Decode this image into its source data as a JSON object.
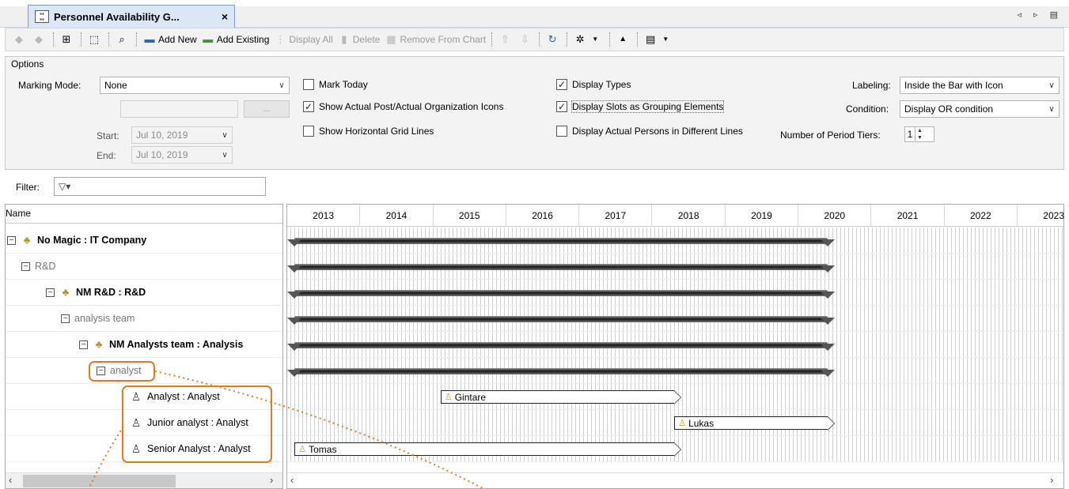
{
  "tab": {
    "title": "Personnel Availability G...",
    "close": "×",
    "nav": "◃ ▹ ▤"
  },
  "toolbar": {
    "add_new": "Add New",
    "add_existing": "Add Existing",
    "display_all": "Display All",
    "delete": "Delete",
    "remove_from_chart": "Remove From Chart"
  },
  "options": {
    "legend": "Options",
    "marking_mode_label": "Marking Mode:",
    "marking_mode_value": "None",
    "start_label": "Start:",
    "start_value": "Jul 10, 2019",
    "end_label": "End:",
    "end_value": "Jul 10, 2019",
    "ellipsis": "...",
    "mark_today": "Mark Today",
    "show_icons": "Show Actual Post/Actual Organization Icons",
    "show_grid": "Show Horizontal Grid Lines",
    "display_types": "Display Types",
    "display_slots": "Display Slots as Grouping Elements",
    "display_persons": "Display Actual Persons in Different Lines",
    "labeling_label": "Labeling:",
    "labeling_value": "Inside the Bar with Icon",
    "condition_label": "Condition:",
    "condition_value": "Display OR condition",
    "tiers_label": "Number of Period Tiers:",
    "tiers_value": "1"
  },
  "filter": {
    "label": "Filter:",
    "icon_text": "▽▾"
  },
  "tree": {
    "header": "Name",
    "rows": [
      {
        "label": "No Magic : IT Company"
      },
      {
        "label": "R&D"
      },
      {
        "label": "NM R&D : R&D"
      },
      {
        "label": "analysis team"
      },
      {
        "label": "NM Analysts team : Analysis"
      },
      {
        "label": "analyst"
      },
      {
        "label": "Analyst : Analyst"
      },
      {
        "label": "Junior analyst : Analyst"
      },
      {
        "label": "Senior Analyst : Analyst"
      }
    ]
  },
  "chart": {
    "years": [
      "2013",
      "2014",
      "2015",
      "2016",
      "2017",
      "2018",
      "2019",
      "2020",
      "2021",
      "2022",
      "2023"
    ],
    "assignments": [
      {
        "name": "Gintare"
      },
      {
        "name": "Lukas"
      },
      {
        "name": "Tomas"
      }
    ]
  },
  "chart_data": {
    "type": "gantt",
    "x_axis": [
      "2013",
      "2014",
      "2015",
      "2016",
      "2017",
      "2018",
      "2019",
      "2020",
      "2021",
      "2022",
      "2023"
    ],
    "summary_rows": [
      {
        "row": "No Magic : IT Company",
        "start": 2013.1,
        "end": 2020.4
      },
      {
        "row": "R&D",
        "start": 2013.1,
        "end": 2020.4
      },
      {
        "row": "NM R&D : R&D",
        "start": 2013.1,
        "end": 2020.4
      },
      {
        "row": "analysis team",
        "start": 2013.1,
        "end": 2020.4
      },
      {
        "row": "NM Analysts team : Analysis",
        "start": 2013.1,
        "end": 2020.4
      },
      {
        "row": "analyst",
        "start": 2013.1,
        "end": 2020.4
      }
    ],
    "assignment_rows": [
      {
        "row": "Analyst : Analyst",
        "person": "Gintare",
        "start": 2015.1,
        "end": 2018.3
      },
      {
        "row": "Junior analyst : Analyst",
        "person": "Lukas",
        "start": 2018.3,
        "end": 2020.4
      },
      {
        "row": "Senior Analyst : Analyst",
        "person": "Tomas",
        "start": 2013.1,
        "end": 2018.3
      }
    ]
  }
}
